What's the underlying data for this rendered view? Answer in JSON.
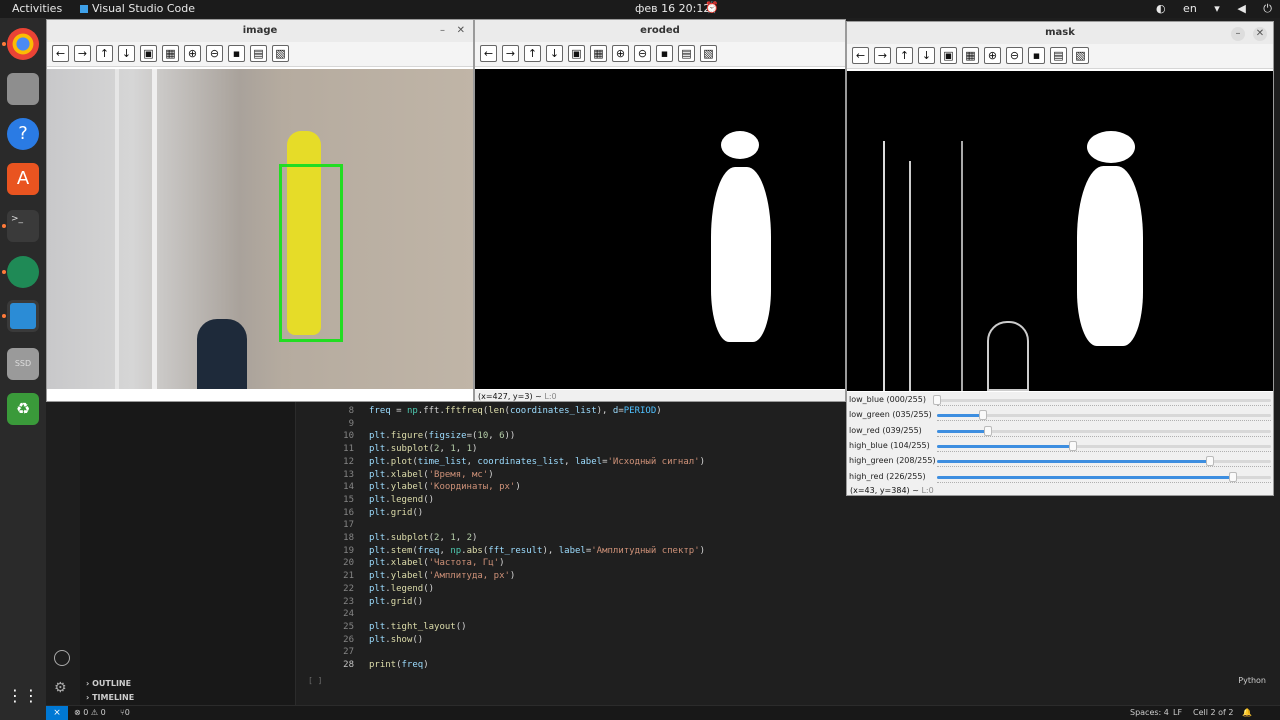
{
  "topbar": {
    "activities": "Activities",
    "app": "Visual Studio Code",
    "clock": "фев 16  20:12",
    "lang": "en"
  },
  "windows": {
    "image": {
      "title": "image"
    },
    "eroded": {
      "title": "eroded",
      "status": "(x=427, y=3) ~",
      "status_l": "L:0"
    },
    "mask": {
      "title": "mask",
      "status": "(x=43, y=384) ~",
      "status_l": "L:0"
    }
  },
  "trackbars": [
    {
      "label": "low_blue",
      "value": "(000/255)",
      "level": 0.0
    },
    {
      "label": "low_green",
      "value": "(035/255)",
      "level": 0.137
    },
    {
      "label": "low_red",
      "value": "(039/255)",
      "level": 0.153
    },
    {
      "label": "high_blue",
      "value": "(104/255)",
      "level": 0.408
    },
    {
      "label": "high_green",
      "value": "(208/255)",
      "level": 0.816
    },
    {
      "label": "high_red",
      "value": "(226/255)",
      "level": 0.886
    }
  ],
  "editor": {
    "lines": [
      {
        "n": "8",
        "tokens": [
          [
            "freq",
            "k-v"
          ],
          [
            " = ",
            "k-p"
          ],
          [
            "np",
            "k-c"
          ],
          [
            ".fft.",
            "k-p"
          ],
          [
            "fftfreq",
            "k-f"
          ],
          [
            "(",
            "k-p"
          ],
          [
            "len",
            "k-f"
          ],
          [
            "(",
            "k-p"
          ],
          [
            "coordinates_list",
            "k-v"
          ],
          [
            "), ",
            "k-p"
          ],
          [
            "d",
            "k-v"
          ],
          [
            "=",
            "k-p"
          ],
          [
            "PERIOD",
            "k-const"
          ],
          [
            ")",
            "k-p"
          ]
        ]
      },
      {
        "n": "9",
        "tokens": []
      },
      {
        "n": "10",
        "tokens": [
          [
            "plt",
            "k-v"
          ],
          [
            ".",
            "k-p"
          ],
          [
            "figure",
            "k-f"
          ],
          [
            "(",
            "k-p"
          ],
          [
            "figsize",
            "k-v"
          ],
          [
            "=(",
            "k-p"
          ],
          [
            "10",
            "k-n"
          ],
          [
            ", ",
            "k-p"
          ],
          [
            "6",
            "k-n"
          ],
          [
            "))",
            "k-p"
          ]
        ]
      },
      {
        "n": "11",
        "tokens": [
          [
            "plt",
            "k-v"
          ],
          [
            ".",
            "k-p"
          ],
          [
            "subplot",
            "k-f"
          ],
          [
            "(",
            "k-p"
          ],
          [
            "2",
            "k-n"
          ],
          [
            ", ",
            "k-p"
          ],
          [
            "1",
            "k-n"
          ],
          [
            ", ",
            "k-p"
          ],
          [
            "1",
            "k-n"
          ],
          [
            ")",
            "k-p"
          ]
        ]
      },
      {
        "n": "12",
        "tokens": [
          [
            "plt",
            "k-v"
          ],
          [
            ".",
            "k-p"
          ],
          [
            "plot",
            "k-f"
          ],
          [
            "(",
            "k-p"
          ],
          [
            "time_list",
            "k-v"
          ],
          [
            ", ",
            "k-p"
          ],
          [
            "coordinates_list",
            "k-v"
          ],
          [
            ", ",
            "k-p"
          ],
          [
            "label",
            "k-v"
          ],
          [
            "=",
            "k-p"
          ],
          [
            "'Исходный сигнал'",
            "k-s"
          ],
          [
            ")",
            "k-p"
          ]
        ]
      },
      {
        "n": "13",
        "tokens": [
          [
            "plt",
            "k-v"
          ],
          [
            ".",
            "k-p"
          ],
          [
            "xlabel",
            "k-f"
          ],
          [
            "(",
            "k-p"
          ],
          [
            "'Время, мс'",
            "k-s"
          ],
          [
            ")",
            "k-p"
          ]
        ]
      },
      {
        "n": "14",
        "tokens": [
          [
            "plt",
            "k-v"
          ],
          [
            ".",
            "k-p"
          ],
          [
            "ylabel",
            "k-f"
          ],
          [
            "(",
            "k-p"
          ],
          [
            "'Координаты, px'",
            "k-s"
          ],
          [
            ")",
            "k-p"
          ]
        ]
      },
      {
        "n": "15",
        "tokens": [
          [
            "plt",
            "k-v"
          ],
          [
            ".",
            "k-p"
          ],
          [
            "legend",
            "k-f"
          ],
          [
            "()",
            "k-p"
          ]
        ]
      },
      {
        "n": "16",
        "tokens": [
          [
            "plt",
            "k-v"
          ],
          [
            ".",
            "k-p"
          ],
          [
            "grid",
            "k-f"
          ],
          [
            "()",
            "k-p"
          ]
        ]
      },
      {
        "n": "17",
        "tokens": []
      },
      {
        "n": "18",
        "tokens": [
          [
            "plt",
            "k-v"
          ],
          [
            ".",
            "k-p"
          ],
          [
            "subplot",
            "k-f"
          ],
          [
            "(",
            "k-p"
          ],
          [
            "2",
            "k-n"
          ],
          [
            ", ",
            "k-p"
          ],
          [
            "1",
            "k-n"
          ],
          [
            ", ",
            "k-p"
          ],
          [
            "2",
            "k-n"
          ],
          [
            ")",
            "k-p"
          ]
        ]
      },
      {
        "n": "19",
        "tokens": [
          [
            "plt",
            "k-v"
          ],
          [
            ".",
            "k-p"
          ],
          [
            "stem",
            "k-f"
          ],
          [
            "(",
            "k-p"
          ],
          [
            "freq",
            "k-v"
          ],
          [
            ", ",
            "k-p"
          ],
          [
            "np",
            "k-c"
          ],
          [
            ".",
            "k-p"
          ],
          [
            "abs",
            "k-f"
          ],
          [
            "(",
            "k-p"
          ],
          [
            "fft_result",
            "k-v"
          ],
          [
            "), ",
            "k-p"
          ],
          [
            "label",
            "k-v"
          ],
          [
            "=",
            "k-p"
          ],
          [
            "'Амплитудный спектр'",
            "k-s"
          ],
          [
            ")",
            "k-p"
          ]
        ]
      },
      {
        "n": "20",
        "tokens": [
          [
            "plt",
            "k-v"
          ],
          [
            ".",
            "k-p"
          ],
          [
            "xlabel",
            "k-f"
          ],
          [
            "(",
            "k-p"
          ],
          [
            "'Частота, Гц'",
            "k-s"
          ],
          [
            ")",
            "k-p"
          ]
        ]
      },
      {
        "n": "21",
        "tokens": [
          [
            "plt",
            "k-v"
          ],
          [
            ".",
            "k-p"
          ],
          [
            "ylabel",
            "k-f"
          ],
          [
            "(",
            "k-p"
          ],
          [
            "'Амплитуда, px'",
            "k-s"
          ],
          [
            ")",
            "k-p"
          ]
        ]
      },
      {
        "n": "22",
        "tokens": [
          [
            "plt",
            "k-v"
          ],
          [
            ".",
            "k-p"
          ],
          [
            "legend",
            "k-f"
          ],
          [
            "()",
            "k-p"
          ]
        ]
      },
      {
        "n": "23",
        "tokens": [
          [
            "plt",
            "k-v"
          ],
          [
            ".",
            "k-p"
          ],
          [
            "grid",
            "k-f"
          ],
          [
            "()",
            "k-p"
          ]
        ]
      },
      {
        "n": "24",
        "tokens": []
      },
      {
        "n": "25",
        "tokens": [
          [
            "plt",
            "k-v"
          ],
          [
            ".",
            "k-p"
          ],
          [
            "tight_layout",
            "k-f"
          ],
          [
            "()",
            "k-p"
          ]
        ]
      },
      {
        "n": "26",
        "tokens": [
          [
            "plt",
            "k-v"
          ],
          [
            ".",
            "k-p"
          ],
          [
            "show",
            "k-f"
          ],
          [
            "()",
            "k-p"
          ]
        ]
      },
      {
        "n": "27",
        "tokens": []
      },
      {
        "n": "28",
        "tokens": [
          [
            "print",
            "k-f"
          ],
          [
            "(",
            "k-p"
          ],
          [
            "freq",
            "k-v"
          ],
          [
            ")",
            "k-p"
          ]
        ]
      }
    ],
    "language": "Python",
    "cell_marker": "[ ]"
  },
  "sidebar": {
    "outline": "OUTLINE",
    "timeline": "TIMELINE"
  },
  "status": {
    "errors": "⊗ 0 ⚠ 0",
    "ports": "⑂0",
    "spaces": "Spaces: 4",
    "eol": "LF",
    "cell": "Cell 2 of 2"
  },
  "colors": {
    "accent": "#0078d4",
    "box": "#22dd22",
    "glove": "#e6dc28"
  }
}
